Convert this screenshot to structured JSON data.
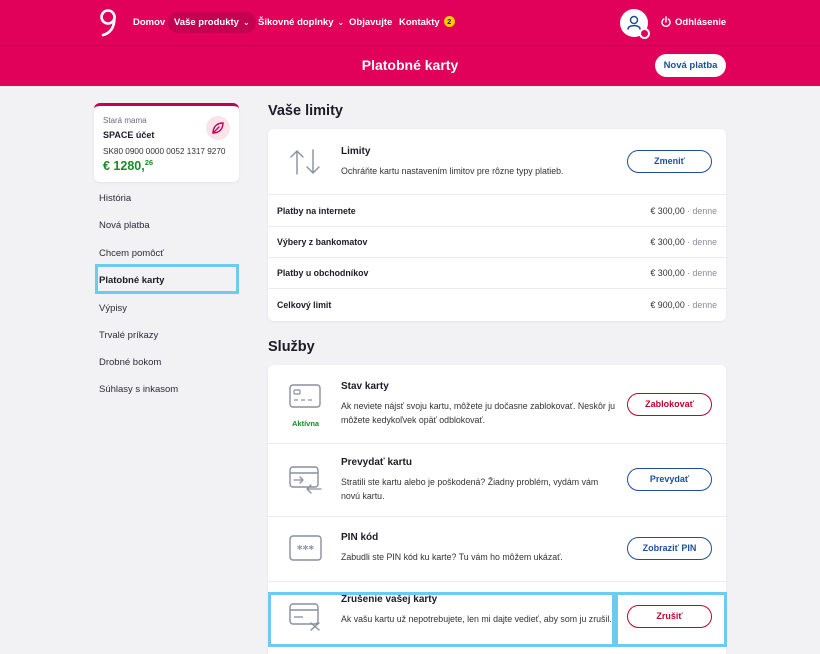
{
  "nav": {
    "items": [
      {
        "label": "Domov"
      },
      {
        "label": "Vaše produkty"
      },
      {
        "label": "Šikovné doplnky"
      },
      {
        "label": "Objavujte"
      },
      {
        "label": "Kontakty"
      }
    ],
    "contacts_badge": "2",
    "logout_label": "Odhlásenie"
  },
  "header": {
    "title": "Platobné karty",
    "new_payment_label": "Nová platba"
  },
  "account": {
    "nickname": "Stará mama",
    "name": "SPACE účet",
    "iban": "SK80 0900 0000 0052 1317 9270",
    "balance_main": "€ 1280,",
    "balance_cents": "26"
  },
  "sidebar": {
    "items": [
      {
        "label": "História"
      },
      {
        "label": "Nová platba"
      },
      {
        "label": "Chcem pomôcť"
      },
      {
        "label": "Platobné karty"
      },
      {
        "label": "Výpisy"
      },
      {
        "label": "Trvalé príkazy"
      },
      {
        "label": "Drobné bokom"
      },
      {
        "label": "Súhlasy s inkasom"
      }
    ]
  },
  "limits": {
    "section_title": "Vaše limity",
    "title": "Limity",
    "description": "Ochráňte kartu nastavením limitov pre rôzne typy platieb.",
    "change_label": "Zmeniť",
    "rows": [
      {
        "label": "Platby na internete",
        "amount": "€ 300,00",
        "period": " · denne"
      },
      {
        "label": "Výbery z bankomatov",
        "amount": "€ 300,00",
        "period": " · denne"
      },
      {
        "label": "Platby u obchodníkov",
        "amount": "€ 300,00",
        "period": " · denne"
      },
      {
        "label": "Celkový limit",
        "amount": "€ 900,00",
        "period": " · denne"
      }
    ]
  },
  "services": {
    "section_title": "Služby",
    "items": [
      {
        "title": "Stav karty",
        "description": "Ak neviete nájsť svoju kartu, môžete ju dočasne zablokovať. Neskôr ju môžete kedykoľvek opäť odblokovať.",
        "button": "Zablokovať",
        "status": "Aktívna"
      },
      {
        "title": "Prevydať kartu",
        "description": "Stratili ste kartu alebo je poškodená? Žiadny problém, vydám vám novú kartu.",
        "button": "Prevydať"
      },
      {
        "title": "PIN kód",
        "description": "Zabudli ste PIN kód ku karte? Tu vám ho môžem ukázať.",
        "button": "Zobraziť PIN"
      },
      {
        "title": "Zrušenie vašej karty",
        "description": "Ak vašu kartu už nepotrebujete, len mi dajte vedieť, aby som ju zrušil.",
        "button": "Zrušiť"
      }
    ]
  },
  "colors": {
    "brand": "#e1005a",
    "link_blue": "#1d4f9e",
    "danger": "#c40030",
    "success": "#1a8a2a",
    "highlight": "#6ccbef"
  }
}
